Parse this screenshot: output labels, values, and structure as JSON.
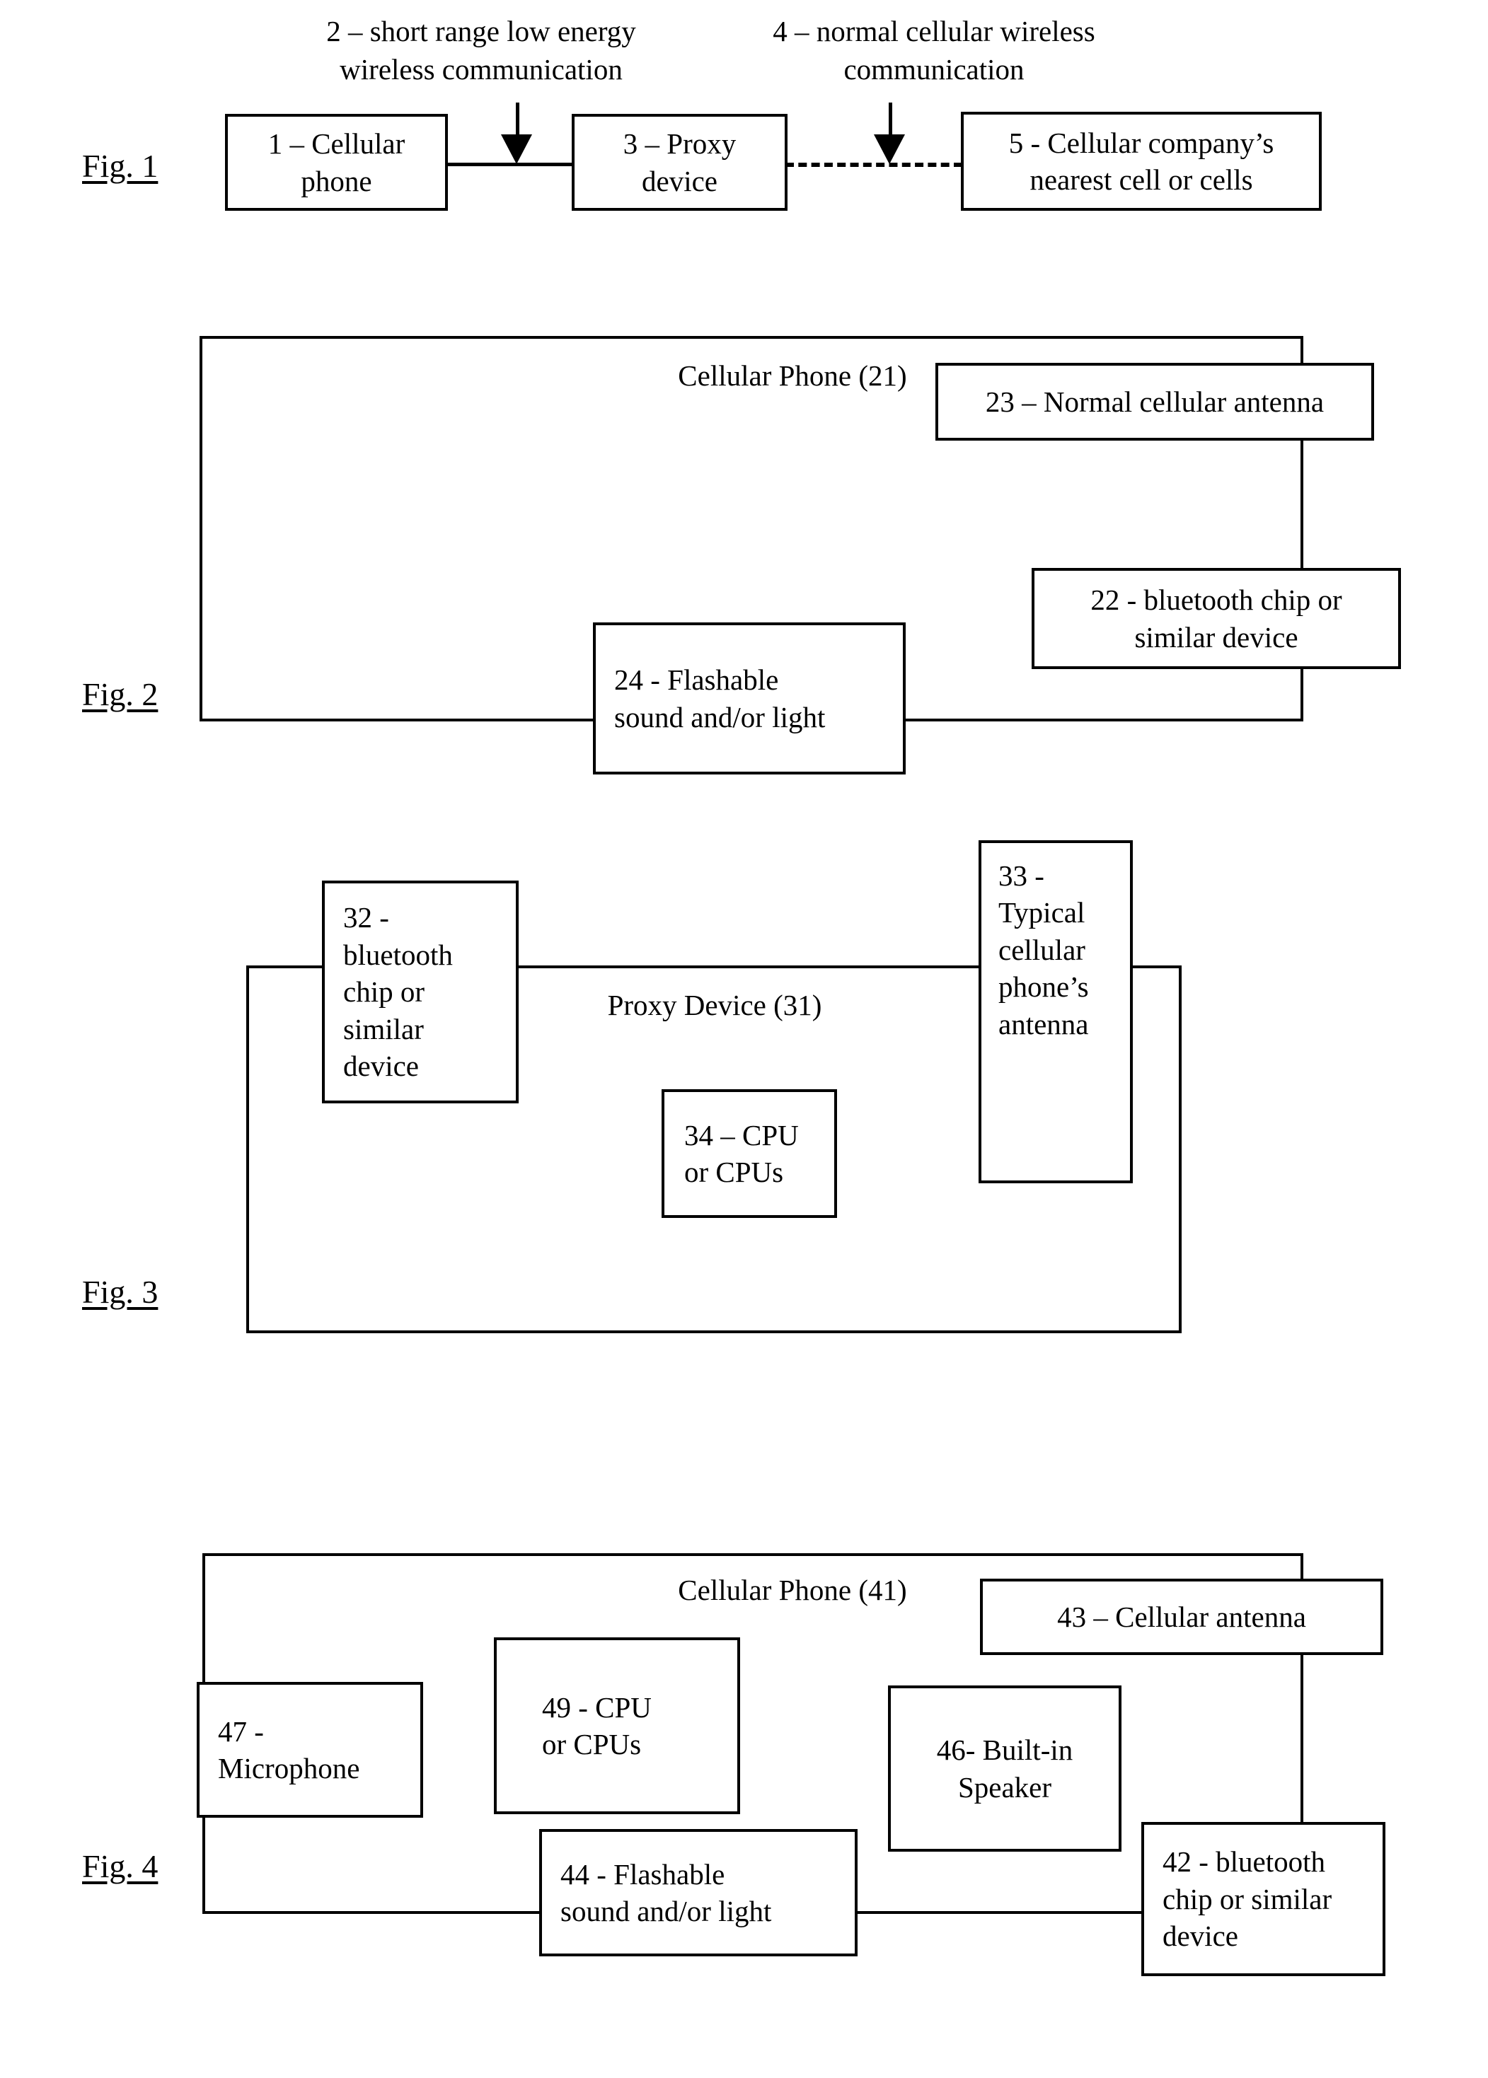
{
  "document": {
    "type": "patent-figure-sheet",
    "figure_count": 4
  },
  "figures": [
    {
      "id": "fig1",
      "label": "Fig. 1",
      "annotations": [
        "2 – short range low energy wireless communication",
        "4 – normal cellular wireless communication"
      ],
      "annotation_lines": {
        "a2_line1": "2 – short range low energy",
        "a2_line2": "wireless communication",
        "a4_line1": "4 – normal cellular wireless",
        "a4_line2": "communication"
      },
      "boxes": [
        {
          "ref": "1",
          "line1": "1 – Cellular",
          "line2": "phone"
        },
        {
          "ref": "3",
          "line1": "3 – Proxy",
          "line2": "device"
        },
        {
          "ref": "5",
          "line1": "5 - Cellular company’s",
          "line2": "nearest cell or cells"
        }
      ]
    },
    {
      "id": "fig2",
      "label": "Fig. 2",
      "container_label": "Cellular Phone (21)",
      "boxes": [
        {
          "ref": "23",
          "line1": "23 – Normal cellular antenna"
        },
        {
          "ref": "22",
          "line1": "22 - bluetooth chip or",
          "line2": "similar device"
        },
        {
          "ref": "24",
          "line1": "24 - Flashable",
          "line2": "sound and/or light"
        }
      ]
    },
    {
      "id": "fig3",
      "label": "Fig. 3",
      "container_label": "Proxy Device (31)",
      "boxes": [
        {
          "ref": "32",
          "line1": "32 -",
          "line2": "bluetooth",
          "line3": "chip or",
          "line4": "similar",
          "line5": "device"
        },
        {
          "ref": "33",
          "line1": "33 -",
          "line2": "Typical",
          "line3": "cellular",
          "line4": "phone’s",
          "line5": "antenna"
        },
        {
          "ref": "34",
          "line1": "34 – CPU",
          "line2": "or CPUs"
        }
      ]
    },
    {
      "id": "fig4",
      "label": "Fig. 4",
      "container_label": "Cellular Phone (41)",
      "boxes": [
        {
          "ref": "43",
          "line1": "43 – Cellular antenna"
        },
        {
          "ref": "47",
          "line1": "47  -",
          "line2": "Microphone"
        },
        {
          "ref": "49",
          "line1": "49 -  CPU",
          "line2": "or CPUs"
        },
        {
          "ref": "46",
          "line1": "46- Built-in",
          "line2": "Speaker"
        },
        {
          "ref": "42",
          "line1": "42 - bluetooth",
          "line2": "chip or similar",
          "line3": "device"
        },
        {
          "ref": "44",
          "line1": "44 -  Flashable",
          "line2": "sound and/or light"
        }
      ]
    }
  ],
  "colors": {
    "ink": "#000000",
    "paper": "#ffffff"
  }
}
